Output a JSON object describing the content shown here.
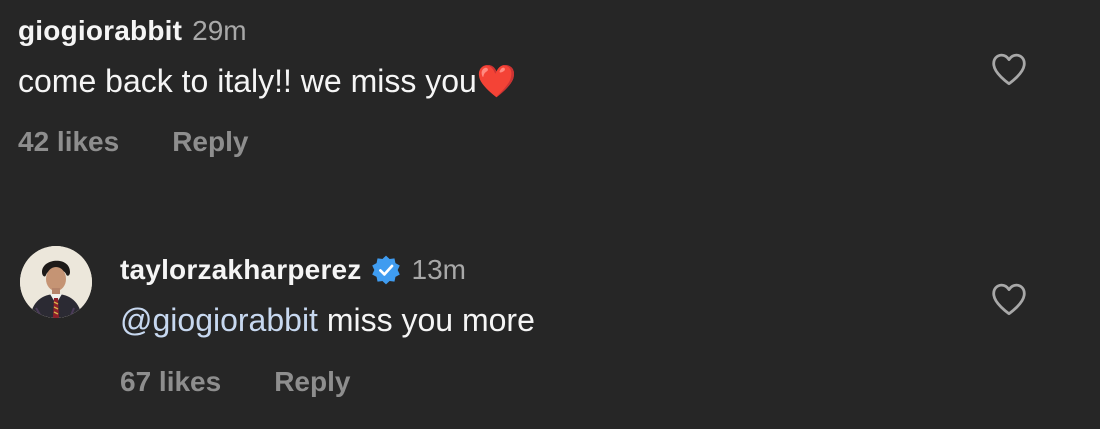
{
  "comments": [
    {
      "username": "giogiorabbit",
      "time": "29m",
      "text": "come back to italy!! we miss you",
      "emoji": "❤️",
      "likes": "42 likes",
      "reply": "Reply"
    },
    {
      "username": "taylorzakharperez",
      "verified": true,
      "time": "13m",
      "mention": "@giogiorabbit",
      "text": " miss you more",
      "likes": "67 likes",
      "reply": "Reply"
    }
  ],
  "colors": {
    "background": "#262626",
    "primary_text": "#f5f5f5",
    "secondary_text": "#a8a8a8",
    "meta_text": "#8e8e8e",
    "mention": "#c7d8f0",
    "verified": "#3f9cf0",
    "heart_emoji": "#e02020"
  },
  "icons": {
    "like": "heart-outline-icon",
    "verified": "verified-badge-icon",
    "emoji": "red-heart-emoji"
  }
}
